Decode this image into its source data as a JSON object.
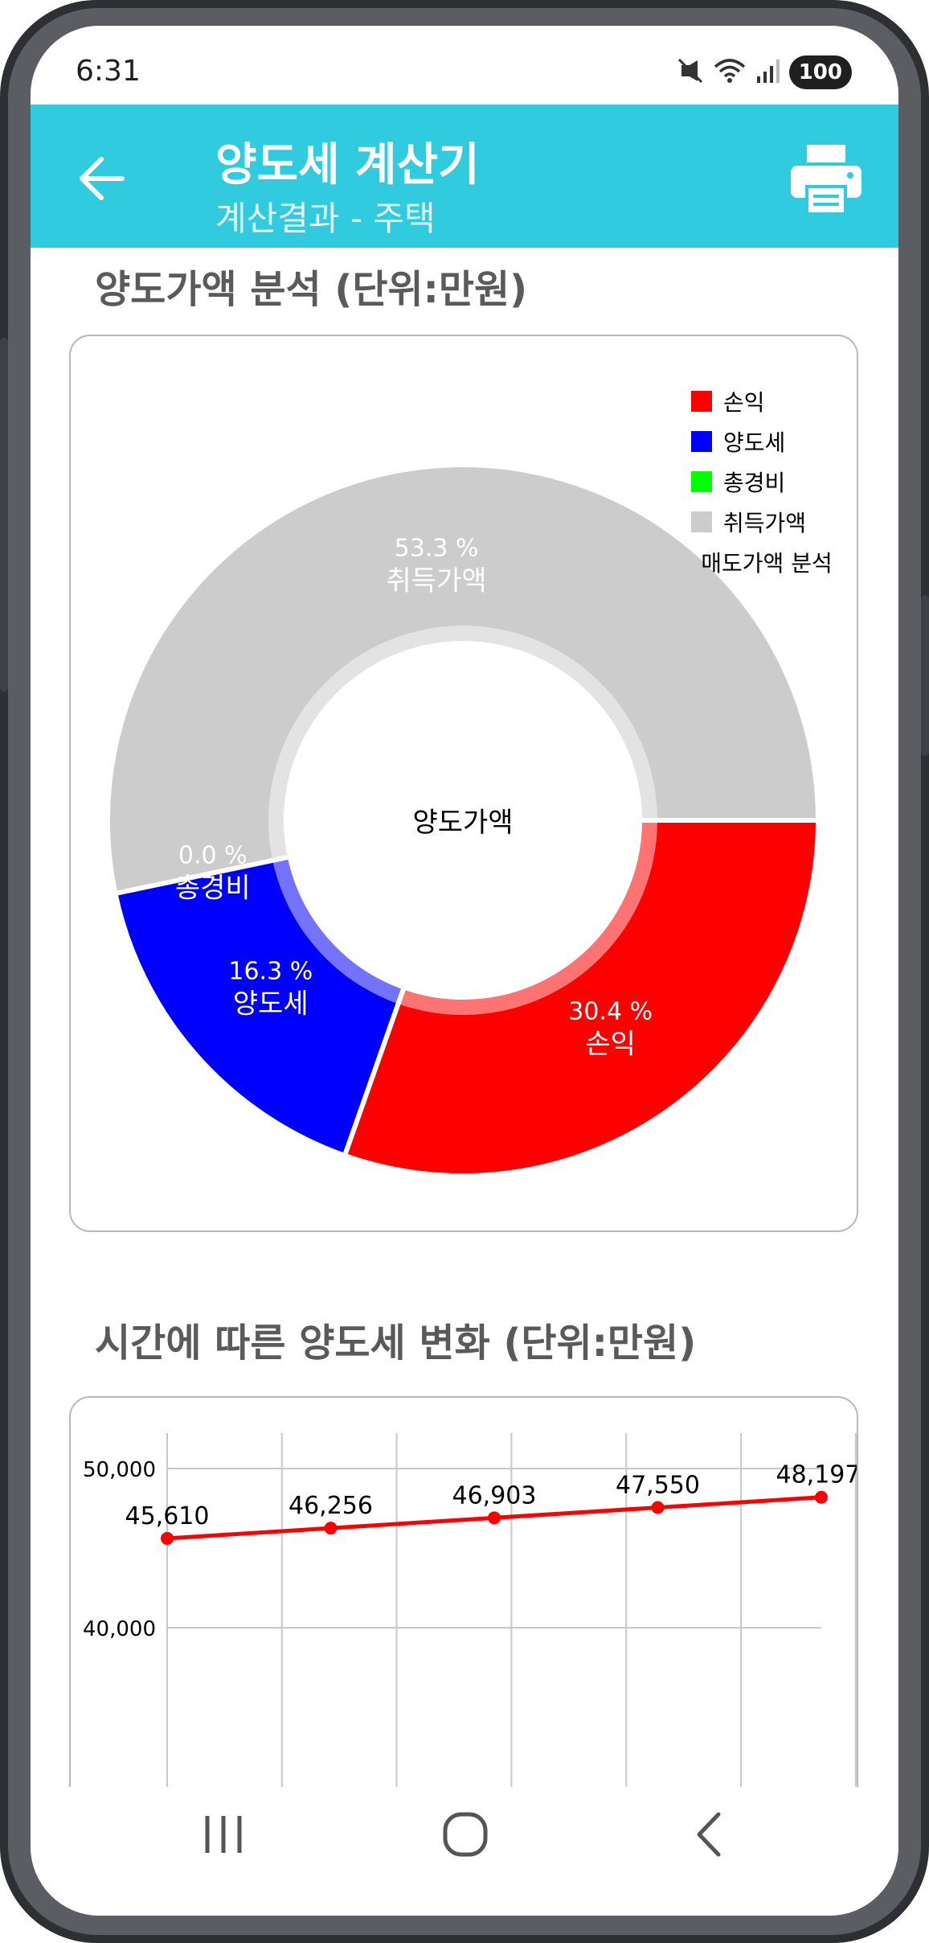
{
  "status": {
    "time": "6:31",
    "battery": "100"
  },
  "app_bar": {
    "title": "양도세 계산기",
    "subtitle": "계산결과 - 주택"
  },
  "sections": [
    {
      "title": "양도가액 분석 (단위:만원)"
    },
    {
      "title": "시간에 따른 양도세 변화 (단위:만원)"
    }
  ],
  "icons": {
    "back": "arrow-back-icon",
    "print": "printer-icon",
    "mute": "vibrate-mute-icon",
    "wifi": "wifi-icon",
    "signal": "signal-icon",
    "recents": "recent-apps-icon",
    "home": "home-icon",
    "nav_back": "chevron-left-icon"
  },
  "chart_data": [
    {
      "type": "pie",
      "center_text": "양도가액",
      "legend_title": "매도가액 분석",
      "slices": [
        {
          "label": "손익",
          "percent": 30.4,
          "percent_label": "30.4 %",
          "color": "#ff0000"
        },
        {
          "label": "양도세",
          "percent": 16.3,
          "percent_label": "16.3 %",
          "color": "#0000ff"
        },
        {
          "label": "총경비",
          "percent": 0.0,
          "percent_label": "0.0 %",
          "color": "#00ff00"
        },
        {
          "label": "취득가액",
          "percent": 53.3,
          "percent_label": "53.3 %",
          "color": "#cccccc"
        }
      ]
    },
    {
      "type": "line",
      "y_ticks": [
        {
          "value": 50000,
          "label": "50,000"
        },
        {
          "value": 40000,
          "label": "40,000"
        }
      ],
      "series": [
        {
          "color": "#ff0000",
          "values": [
            45610,
            46256,
            46903,
            47550,
            48197
          ],
          "labels": [
            "45,610",
            "46,256",
            "46,903",
            "47,550",
            "48,197"
          ]
        }
      ],
      "grid": true
    }
  ]
}
